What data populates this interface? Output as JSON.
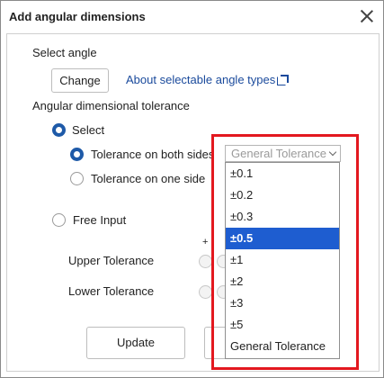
{
  "window": {
    "title": "Add angular dimensions",
    "close_icon": "close-icon"
  },
  "angle": {
    "label": "Select angle",
    "change_button": "Change",
    "link": "About selectable angle types",
    "link_icon": "external-link-icon"
  },
  "tolerance": {
    "label": "Angular dimensional tolerance",
    "select_label": "Select",
    "both_sides_label": "Tolerance on both sides",
    "one_side_label": "Tolerance on one side",
    "free_input_label": "Free Input",
    "plus_minus_header": "+ -",
    "upper_label": "Upper Tolerance",
    "lower_label": "Lower Tolerance",
    "dropdown_value": "General Tolerance",
    "options": [
      "±0.1",
      "±0.2",
      "±0.3",
      "±0.5",
      "±1",
      "±2",
      "±3",
      "±5",
      "General Tolerance"
    ],
    "selected_option": "±0.5"
  },
  "footer": {
    "update_button": "Update"
  },
  "colors": {
    "accent": "#1e5aa8",
    "highlight": "#1e5dd0",
    "annotation": "#e3181f",
    "link": "#1a4a9c"
  }
}
